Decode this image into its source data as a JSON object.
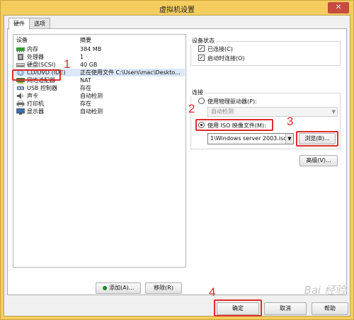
{
  "window": {
    "title": "虚拟机设置",
    "close_glyph": "✕"
  },
  "tabs": [
    {
      "label": "硬件"
    },
    {
      "label": "选项"
    }
  ],
  "device_list": {
    "columns": {
      "device": "设备",
      "summary": "摘要"
    },
    "rows": [
      {
        "name": "内存",
        "summary": "384 MB",
        "icon": "memory-icon"
      },
      {
        "name": "处理器",
        "summary": "1",
        "icon": "processor-icon"
      },
      {
        "name": "硬盘(SCSI)",
        "summary": "40 GB",
        "icon": "hard-disk-icon"
      },
      {
        "name": "CD/DVD (IDE)",
        "summary": "正在使用文件 C:\\Users\\mac\\Deskto...",
        "icon": "cd-dvd-icon"
      },
      {
        "name": "网络适配器",
        "summary": "NAT",
        "icon": "network-adapter-icon"
      },
      {
        "name": "USB 控制器",
        "summary": "存在",
        "icon": "usb-controller-icon"
      },
      {
        "name": "声卡",
        "summary": "自动检测",
        "icon": "sound-card-icon"
      },
      {
        "name": "打印机",
        "summary": "存在",
        "icon": "printer-icon"
      },
      {
        "name": "显示器",
        "summary": "自动检测",
        "icon": "display-icon"
      }
    ]
  },
  "buttons": {
    "add": "添加(A)...",
    "remove": "移除(R)",
    "browse": "浏览(B)...",
    "advanced": "高级(V)...",
    "ok": "确定",
    "cancel": "取消",
    "help": "帮助"
  },
  "device_status": {
    "group_label": "设备状态",
    "connected": "已连接(C)",
    "connect_at_power_on": "启动时连接(O)"
  },
  "connection": {
    "group_label": "连接",
    "use_physical_drive": "使用物理驱动器(P):",
    "physical_drive_value": "自动检测",
    "use_iso": "使用 ISO 映像文件(M):",
    "iso_path": "1\\Windows server 2003.iso"
  },
  "markers": [
    "1",
    "2",
    "3",
    "4"
  ],
  "check_glyph": "✓",
  "watermark": "Bai 经验",
  "colors": {
    "annotation_red": "#e12b2b",
    "title_bar": "#f5cd5e",
    "selection": "#dbe8f8"
  }
}
